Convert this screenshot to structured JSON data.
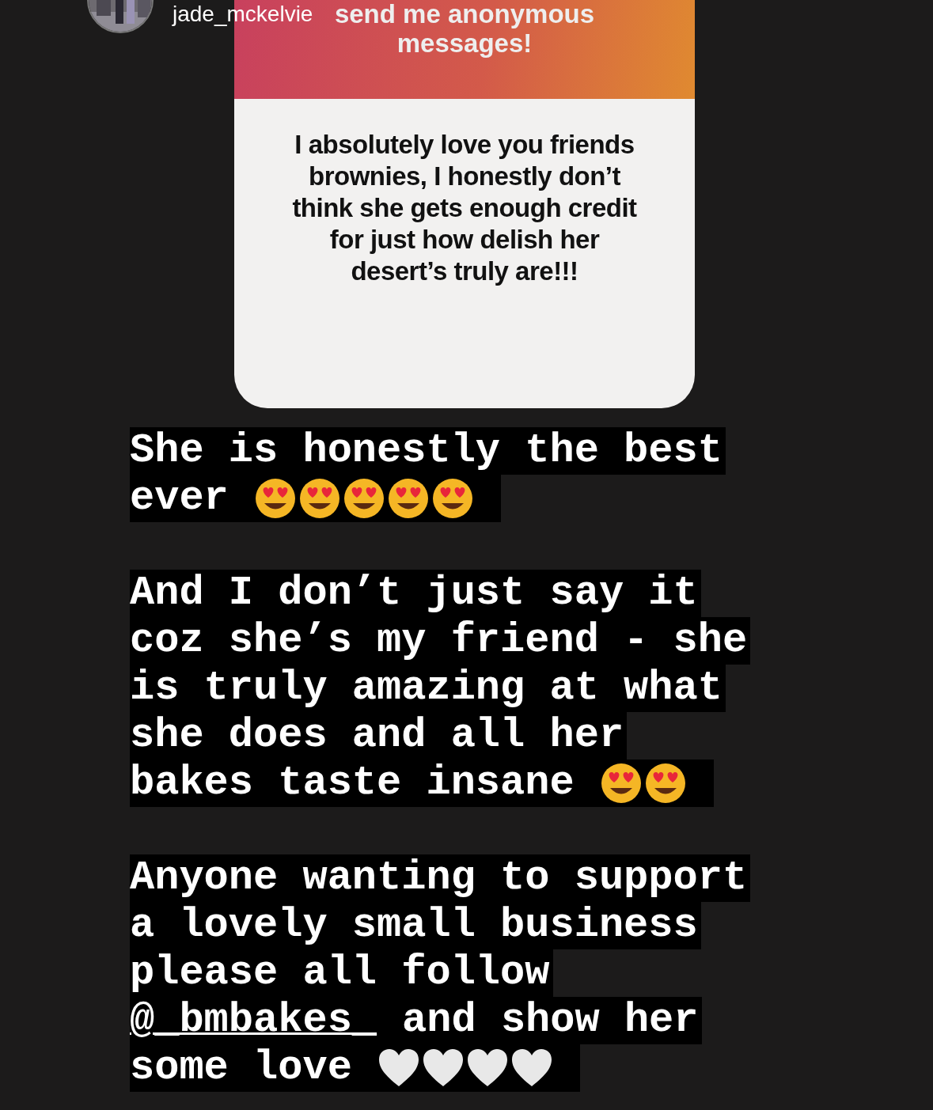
{
  "header": {
    "username": "jade_mckelvie"
  },
  "question_card": {
    "title": "send me anonymous messages!",
    "answer": "I absolutely love you friends brownies, I honestly don’t think she gets enough credit for just how delish her desert’s truly are!!!"
  },
  "caption": [
    {
      "lines": [
        {
          "segments": [
            {
              "text": "She is honestly the best",
              "kind": "plain"
            }
          ]
        },
        {
          "segments": [
            {
              "text": "ever",
              "kind": "plain"
            }
          ],
          "icons": [
            {
              "kind": "heart-eyes"
            },
            {
              "kind": "heart-eyes"
            },
            {
              "kind": "heart-eyes"
            },
            {
              "kind": "heart-eyes"
            },
            {
              "kind": "heart-eyes"
            }
          ]
        }
      ]
    },
    {
      "lines": [
        {
          "segments": [
            {
              "text": "And I don’t just say it",
              "kind": "plain"
            }
          ]
        },
        {
          "segments": [
            {
              "text": "coz she’s my friend - she",
              "kind": "plain"
            }
          ]
        },
        {
          "segments": [
            {
              "text": "is truly amazing at what",
              "kind": "plain"
            }
          ]
        },
        {
          "segments": [
            {
              "text": "she does and all her",
              "kind": "plain"
            }
          ]
        },
        {
          "segments": [
            {
              "text": "bakes taste insane",
              "kind": "plain"
            }
          ],
          "icons": [
            {
              "kind": "heart-eyes"
            },
            {
              "kind": "heart-eyes"
            }
          ]
        }
      ]
    },
    {
      "lines": [
        {
          "segments": [
            {
              "text": "Anyone wanting to support",
              "kind": "plain"
            }
          ]
        },
        {
          "segments": [
            {
              "text": "a lovely small business",
              "kind": "plain"
            }
          ]
        },
        {
          "segments": [
            {
              "text": "please all follow",
              "kind": "plain"
            }
          ]
        },
        {
          "segments": [
            {
              "text": "@_bmbakes_",
              "kind": "mention"
            },
            {
              "text": "and show her",
              "kind": "plain"
            }
          ]
        },
        {
          "segments": [
            {
              "text": "some love",
              "kind": "plain"
            }
          ],
          "icons": [
            {
              "kind": "white-heart"
            },
            {
              "kind": "white-heart"
            },
            {
              "kind": "white-heart"
            },
            {
              "kind": "white-heart"
            }
          ]
        }
      ]
    }
  ]
}
